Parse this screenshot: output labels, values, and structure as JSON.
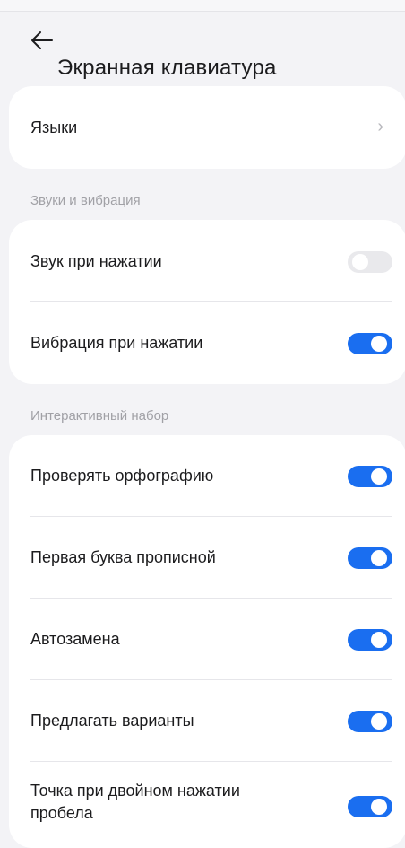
{
  "header": {
    "back_icon": "arrow-left-icon",
    "title": "Экранная клавиатура"
  },
  "languages": {
    "label": "Языки",
    "chevron": "›"
  },
  "sounds_section": {
    "title": "Звуки и вибрация",
    "items": [
      {
        "label": "Звук при нажатии",
        "enabled": false
      },
      {
        "label": "Вибрация при нажатии",
        "enabled": true
      }
    ]
  },
  "typing_section": {
    "title": "Интерактивный набор",
    "items": [
      {
        "label": "Проверять орфографию",
        "enabled": true
      },
      {
        "label": "Первая буква прописной",
        "enabled": true
      },
      {
        "label": "Автозамена",
        "enabled": true
      },
      {
        "label": "Предлагать варианты",
        "enabled": true
      },
      {
        "label": "Точка при двойном нажатии\nпробела",
        "enabled": true
      }
    ]
  },
  "colors": {
    "accent": "#1a6ef0",
    "background": "#f3f3f6",
    "card": "#ffffff",
    "toggle_off": "#e9e9ec"
  }
}
